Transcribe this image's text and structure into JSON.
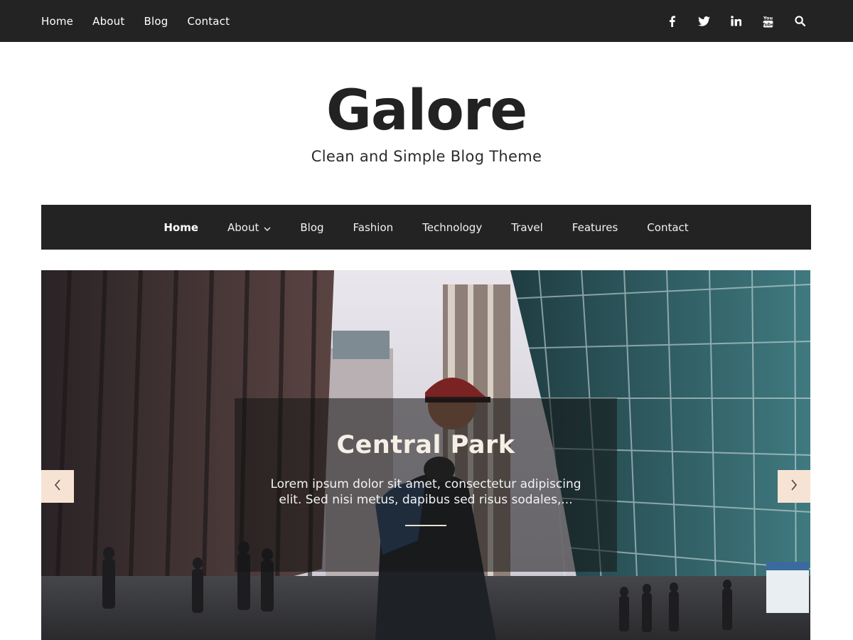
{
  "topbar": {
    "nav": [
      "Home",
      "About",
      "Blog",
      "Contact"
    ],
    "social": [
      {
        "icon": "facebook-icon"
      },
      {
        "icon": "twitter-icon"
      },
      {
        "icon": "linkedin-icon"
      },
      {
        "icon": "youtube-icon"
      },
      {
        "icon": "search-icon"
      }
    ]
  },
  "brand": {
    "title": "Galore",
    "description": "Clean and Simple Blog Theme"
  },
  "main_nav": {
    "items": [
      {
        "label": "Home",
        "active": true
      },
      {
        "label": "About",
        "has_dropdown": true
      },
      {
        "label": "Blog"
      },
      {
        "label": "Fashion"
      },
      {
        "label": "Technology"
      },
      {
        "label": "Travel"
      },
      {
        "label": "Features"
      },
      {
        "label": "Contact"
      }
    ]
  },
  "slider": {
    "title": "Central Park",
    "excerpt": "Lorem ipsum dolor sit amet, consectetur adipiscing elit. Sed nisi metus, dapibus sed risus sodales,...",
    "prev_icon": "chevron-left-icon",
    "next_icon": "chevron-right-icon"
  },
  "colors": {
    "bar": "#232323",
    "arrow_bg": "#f7e3d4",
    "text_dark": "#222222"
  }
}
